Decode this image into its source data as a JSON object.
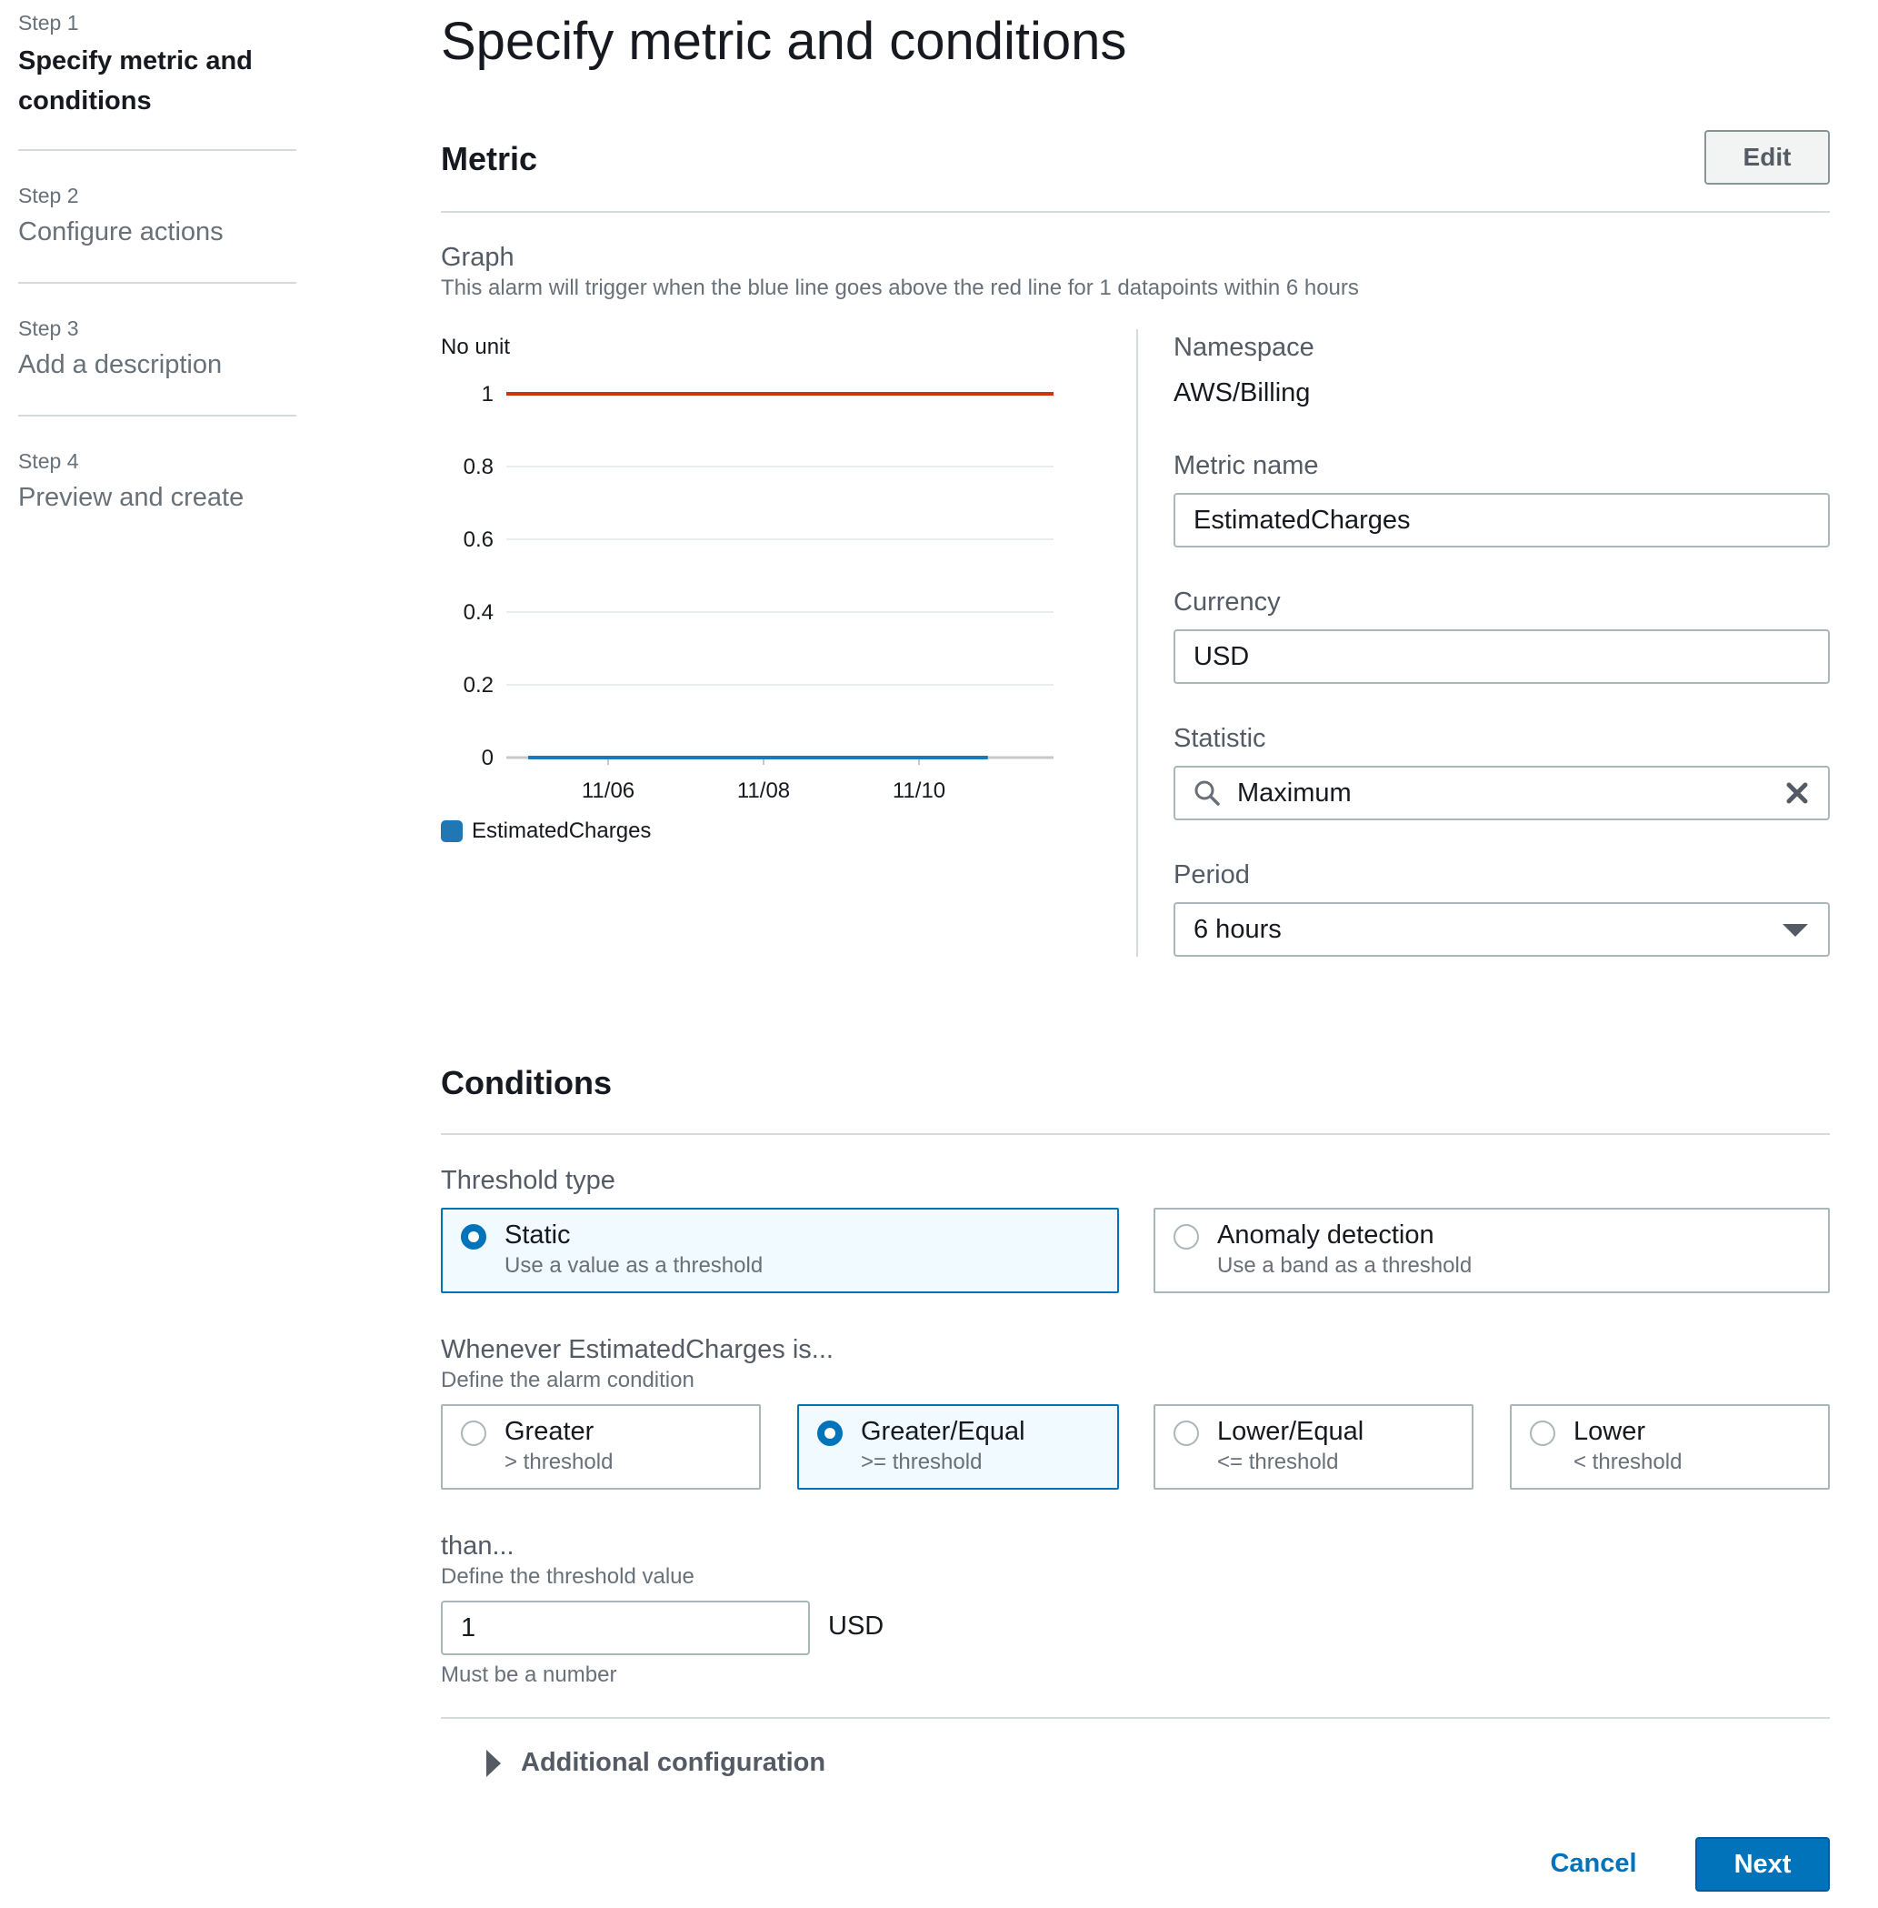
{
  "steps": [
    {
      "num": "Step 1",
      "label": "Specify metric and conditions",
      "active": true
    },
    {
      "num": "Step 2",
      "label": "Configure actions",
      "active": false
    },
    {
      "num": "Step 3",
      "label": "Add a description",
      "active": false
    },
    {
      "num": "Step 4",
      "label": "Preview and create",
      "active": false
    }
  ],
  "page_title": "Specify metric and conditions",
  "metric": {
    "heading": "Metric",
    "edit_label": "Edit",
    "graph_title": "Graph",
    "graph_subtitle": "This alarm will trigger when the blue line goes above the red line for 1 datapoints within 6 hours",
    "unit_label": "No unit",
    "legend_label": "EstimatedCharges",
    "namespace_label": "Namespace",
    "namespace_value": "AWS/Billing",
    "metric_name_label": "Metric name",
    "metric_name_value": "EstimatedCharges",
    "currency_label": "Currency",
    "currency_value": "USD",
    "statistic_label": "Statistic",
    "statistic_value": "Maximum",
    "period_label": "Period",
    "period_value": "6 hours"
  },
  "chart_data": {
    "type": "line",
    "ylabel": "No unit",
    "ylim": [
      0,
      1
    ],
    "y_ticks": [
      "0",
      "0.2",
      "0.4",
      "0.6",
      "0.8",
      "1"
    ],
    "x_ticks": [
      "11/06",
      "11/08",
      "11/10"
    ],
    "series": [
      {
        "name": "EstimatedCharges",
        "color": "#1f77b4",
        "x": [
          0.04,
          0.88
        ],
        "values": [
          0,
          0
        ]
      },
      {
        "name": "",
        "color": "#d13212",
        "x": [
          0.0,
          1.0
        ],
        "values": [
          1,
          1
        ]
      }
    ]
  },
  "conditions": {
    "heading": "Conditions",
    "threshold_type_label": "Threshold type",
    "threshold_types": [
      {
        "title": "Static",
        "sub": "Use a value as a threshold",
        "selected": true
      },
      {
        "title": "Anomaly detection",
        "sub": "Use a band as a threshold",
        "selected": false
      }
    ],
    "whenever_label": "Whenever EstimatedCharges is...",
    "whenever_sub": "Define the alarm condition",
    "operators": [
      {
        "title": "Greater",
        "sub": "> threshold",
        "selected": false
      },
      {
        "title": "Greater/Equal",
        "sub": ">= threshold",
        "selected": true
      },
      {
        "title": "Lower/Equal",
        "sub": "<= threshold",
        "selected": false
      },
      {
        "title": "Lower",
        "sub": "< threshold",
        "selected": false
      }
    ],
    "than_label": "than...",
    "than_sub": "Define the threshold value",
    "threshold_value": "1",
    "threshold_unit": "USD",
    "threshold_hint": "Must be a number",
    "additional_config": "Additional configuration"
  },
  "footer": {
    "cancel_label": "Cancel",
    "next_label": "Next"
  },
  "colors": {
    "accent": "#0073bb",
    "threshold_line": "#d13212",
    "metric_line": "#1f77b4"
  }
}
